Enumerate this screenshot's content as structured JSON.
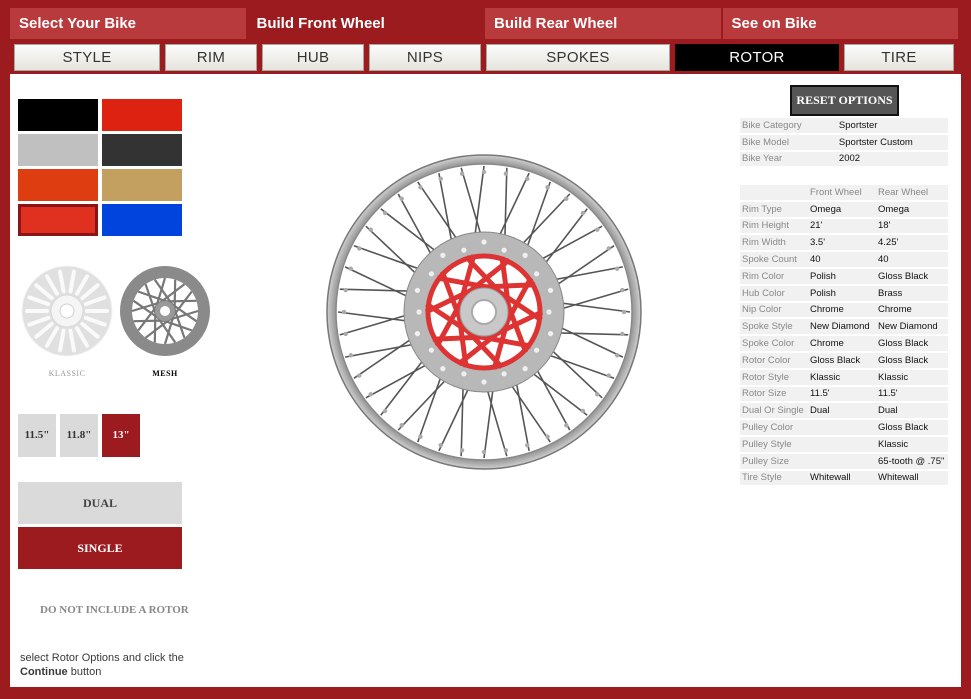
{
  "steps": [
    "Select Your Bike",
    "Build Front Wheel",
    "Build Rear Wheel",
    "See on Bike"
  ],
  "subtabs": [
    "STYLE",
    "RIM",
    "HUB",
    "NIPS",
    "SPOKES",
    "ROTOR",
    "TIRE"
  ],
  "active_subtab": "ROTOR",
  "colors": {
    "brand_red": "#9c1b1f",
    "swatches": [
      "#000000",
      "#dd2211",
      "#c0c0c0",
      "#333333",
      "#dd3d11",
      "#c4a060",
      "#e03020",
      "#0044dd"
    ],
    "selected_swatch": 6
  },
  "rotor_styles": {
    "klassic": "KLASSIC",
    "mesh": "MESH"
  },
  "rotor_sizes": [
    "11.5\"",
    "11.8\"",
    "13\""
  ],
  "selected_size": "13\"",
  "mode": {
    "dual": "DUAL",
    "single": "SINGLE"
  },
  "no_rotor": "DO NOT INCLUDE A ROTOR",
  "instructions": {
    "line1": "select Rotor Options and click the",
    "continue": "Continue",
    "button": " button"
  },
  "reset_label": "RESET OPTIONS",
  "bike_info": [
    [
      "Bike Category",
      "Sportster"
    ],
    [
      "Bike Model",
      "Sportster Custom"
    ],
    [
      "Bike Year",
      "2002"
    ]
  ],
  "spec_headers": [
    "Front Wheel",
    "Rear Wheel"
  ],
  "specs": [
    [
      "Rim Type",
      "Omega",
      "Omega"
    ],
    [
      "Rim Height",
      "21'",
      "18'"
    ],
    [
      "Rim Width",
      "3.5'",
      "4.25'"
    ],
    [
      "Spoke Count",
      "40",
      "40"
    ],
    [
      "Rim Color",
      "Polish",
      "Gloss Black"
    ],
    [
      "Hub Color",
      "Polish",
      "Brass"
    ],
    [
      "Nip Color",
      "Chrome",
      "Chrome"
    ],
    [
      "Spoke Style",
      "New Diamond",
      "New Diamond"
    ],
    [
      "Spoke Color",
      "Chrome",
      "Gloss Black"
    ],
    [
      "Rotor Color",
      "Gloss Black",
      "Gloss Black"
    ],
    [
      "Rotor Style",
      "Klassic",
      "Klassic"
    ],
    [
      "Rotor Size",
      "11.5'",
      "11.5'"
    ],
    [
      "Dual Or Single",
      "Dual",
      "Dual"
    ],
    [
      "Pulley Color",
      "",
      "Gloss Black"
    ],
    [
      "Pulley Style",
      "",
      "Klassic"
    ],
    [
      "Pulley Size",
      "",
      "65-tooth @ .75\""
    ],
    [
      "Tire Style",
      "Whitewall",
      "Whitewall"
    ]
  ]
}
